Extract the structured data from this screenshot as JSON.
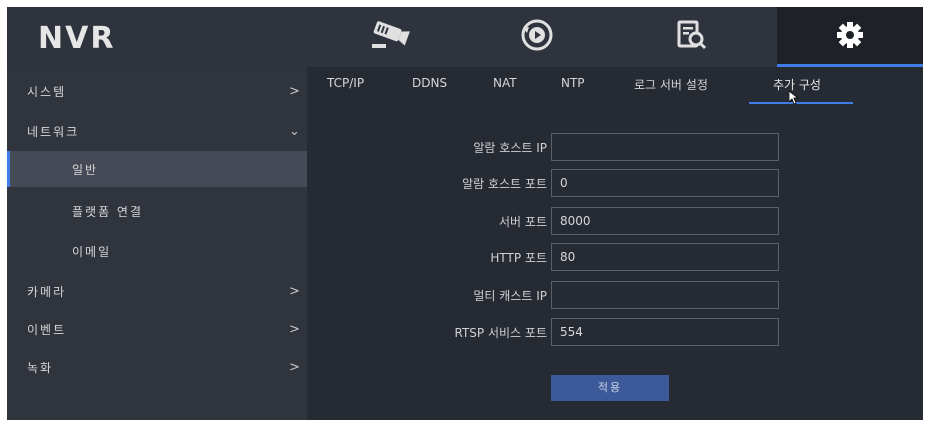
{
  "app": {
    "logo": "NVR"
  },
  "top_nav": [
    {
      "icon": "camera-icon"
    },
    {
      "icon": "playback-icon"
    },
    {
      "icon": "search-log-icon"
    },
    {
      "icon": "gear-icon",
      "active": true
    }
  ],
  "sidebar": {
    "items": [
      {
        "label": "시스템",
        "chevron": ">"
      },
      {
        "label": "네트워크",
        "chevron": "⌄"
      },
      {
        "label": "일반"
      },
      {
        "label": "플랫폼 연결"
      },
      {
        "label": "이메일"
      },
      {
        "label": "카메라",
        "chevron": ">"
      },
      {
        "label": "이벤트",
        "chevron": ">"
      },
      {
        "label": "녹화",
        "chevron": ">"
      }
    ]
  },
  "tabs": [
    "TCP/IP",
    "DDNS",
    "NAT",
    "NTP",
    "로그 서버 설정",
    "추가 구성"
  ],
  "form": {
    "fields": [
      {
        "label": "알람 호스트 IP",
        "value": ""
      },
      {
        "label": "알람 호스트 포트",
        "value": "0"
      },
      {
        "label": "서버 포트",
        "value": "8000"
      },
      {
        "label": "HTTP 포트",
        "value": "80"
      },
      {
        "label": "멀티 캐스트 IP",
        "value": ""
      },
      {
        "label": "RTSP 서비스 포트",
        "value": "554"
      }
    ],
    "apply_label": "적용"
  },
  "colors": {
    "accent": "#3f7ee8",
    "background": "#262a33",
    "sidebar": "#30343d",
    "selected": "#454a56"
  }
}
